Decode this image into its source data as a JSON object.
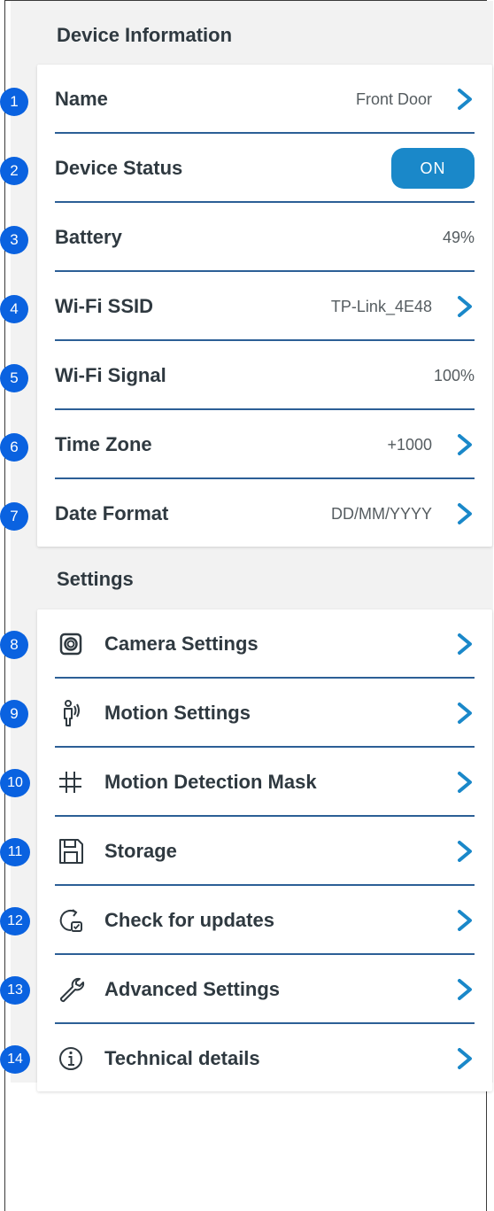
{
  "device_info": {
    "section_title": "Device Information",
    "rows": [
      {
        "label": "Name",
        "value": "Front Door"
      },
      {
        "label": "Device Status",
        "toggle": "ON"
      },
      {
        "label": "Battery",
        "value": "49%"
      },
      {
        "label": "Wi-Fi SSID",
        "value": "TP-Link_4E48"
      },
      {
        "label": "Wi-Fi Signal",
        "value": "100%"
      },
      {
        "label": "Time Zone",
        "value": "+1000"
      },
      {
        "label": "Date Format",
        "value": "DD/MM/YYYY"
      }
    ]
  },
  "settings": {
    "section_title": "Settings",
    "rows": [
      {
        "label": "Camera Settings",
        "icon": "camera-icon"
      },
      {
        "label": "Motion Settings",
        "icon": "motion-person-icon"
      },
      {
        "label": "Motion Detection Mask",
        "icon": "grid-icon"
      },
      {
        "label": "Storage",
        "icon": "floppy-disk-icon"
      },
      {
        "label": "Check for updates",
        "icon": "update-check-icon"
      },
      {
        "label": "Advanced Settings",
        "icon": "wrench-icon"
      },
      {
        "label": "Technical details",
        "icon": "info-icon"
      }
    ]
  },
  "markers": [
    "1",
    "2",
    "3",
    "4",
    "5",
    "6",
    "7",
    "8",
    "9",
    "10",
    "11",
    "12",
    "13",
    "14"
  ],
  "colors": {
    "accent": "#1a88c9",
    "divider": "#2c5f96",
    "marker": "#0a62e0",
    "text": "#2f3940",
    "background": "#f2f2f2"
  }
}
